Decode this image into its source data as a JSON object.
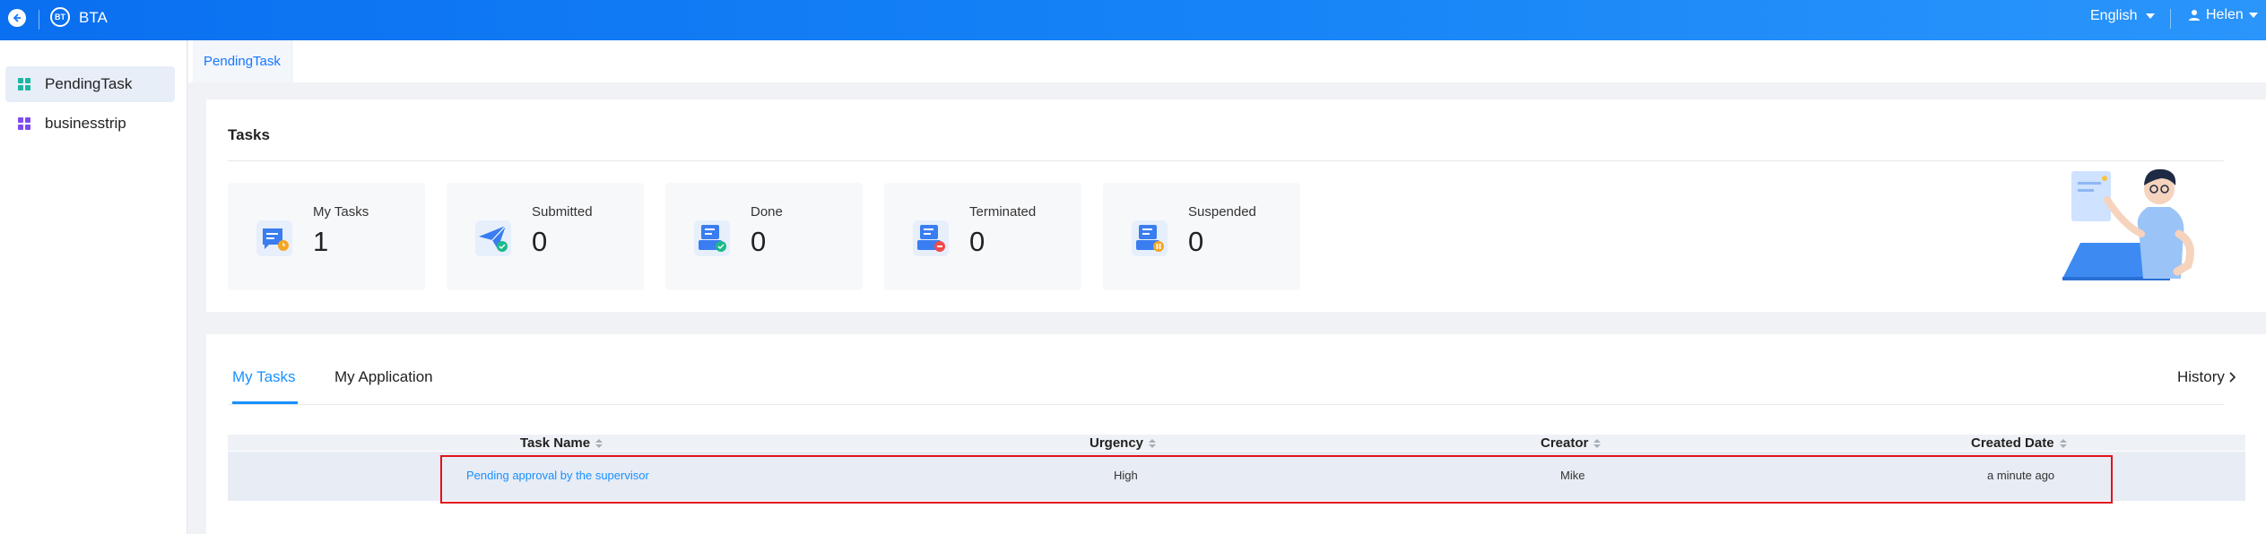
{
  "header": {
    "app_title": "BTA",
    "logo_text": "BT",
    "language": "English",
    "user_name": "Helen",
    "colors": {
      "gradient_start": "#0a6ff0",
      "gradient_end": "#2a95fb"
    }
  },
  "sidebar": {
    "items": [
      {
        "label": "PendingTask",
        "active": true,
        "icon": "grid-icon",
        "icon_color": "#1bb7a4"
      },
      {
        "label": "businesstrip",
        "active": false,
        "icon": "grid-icon",
        "icon_color": "#7d4bef"
      }
    ]
  },
  "tabs": {
    "open_page": "PendingTask"
  },
  "tasks_card": {
    "title": "Tasks",
    "stats": [
      {
        "label": "My Tasks",
        "value": "1",
        "icon": "chat-clock-icon"
      },
      {
        "label": "Submitted",
        "value": "0",
        "icon": "paper-plane-icon"
      },
      {
        "label": "Done",
        "value": "0",
        "icon": "inbox-check-icon"
      },
      {
        "label": "Terminated",
        "value": "0",
        "icon": "inbox-stop-icon"
      },
      {
        "label": "Suspended",
        "value": "0",
        "icon": "inbox-pause-icon"
      }
    ]
  },
  "list_card": {
    "tabs": [
      {
        "label": "My Tasks",
        "active": true
      },
      {
        "label": "My Application",
        "active": false
      }
    ],
    "history_label": "History",
    "columns": [
      "Task Name",
      "Urgency",
      "Creator",
      "Created Date"
    ],
    "rows": [
      {
        "task_name": "Pending approval by the supervisor",
        "urgency": "High",
        "creator": "Mike",
        "created_date": "a minute ago"
      }
    ],
    "accent": "#1890ff"
  }
}
